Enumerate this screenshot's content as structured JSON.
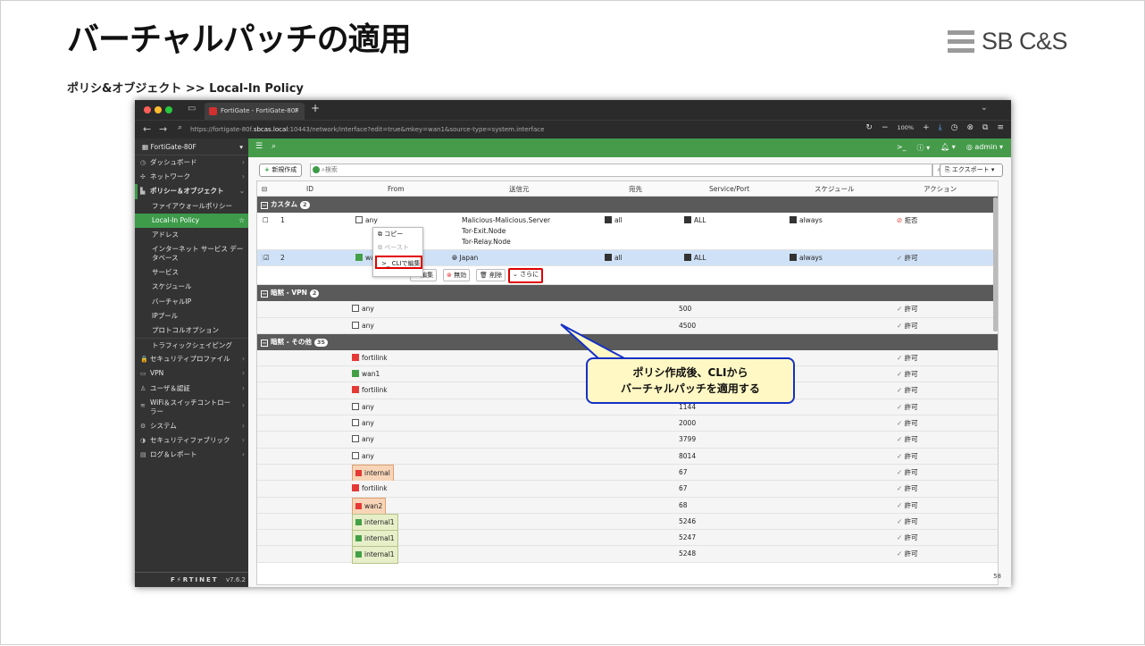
{
  "slide": {
    "title": "バーチャルパッチの適用",
    "brand": "SB C&S",
    "subtitle": "ポリシ&オブジェクト >> Local-In Policy"
  },
  "browser": {
    "tab_title": "FortiGate - FortiGate-80F",
    "url_prefix": "https://fortigate-80f.",
    "url_host": "sbcas.local",
    "url_suffix": ":10443/network/interface?edit=true&mkey=wan1&source-type=system.interface",
    "zoom": "100%"
  },
  "sidebar": {
    "device": "FortiGate-80F",
    "items": [
      {
        "label": "ダッシュボード",
        "icon": "◷",
        "arrow": "›"
      },
      {
        "label": "ネットワーク",
        "icon": "✣",
        "arrow": "›"
      },
      {
        "label": "ポリシー＆オブジェクト",
        "icon": "▙",
        "arrow": "⌄"
      },
      {
        "label": "ファイアウォールポリシー"
      },
      {
        "label": "Local-In Policy"
      },
      {
        "label": "アドレス"
      },
      {
        "label": "インターネット サービス データベース"
      },
      {
        "label": "サービス"
      },
      {
        "label": "スケジュール"
      },
      {
        "label": "バーチャルIP"
      },
      {
        "label": "IPプール"
      },
      {
        "label": "プロトコルオプション"
      },
      {
        "label": "トラフィックシェイピング"
      },
      {
        "label": "セキュリティプロファイル",
        "icon": "🔒",
        "arrow": "›"
      },
      {
        "label": "VPN",
        "icon": "▭",
        "arrow": "›"
      },
      {
        "label": "ユーザ＆認証",
        "icon": "♙",
        "arrow": "›"
      },
      {
        "label": "WiFi＆スイッチコントローラー",
        "icon": "≋",
        "arrow": "›"
      },
      {
        "label": "システム",
        "icon": "⚙",
        "arrow": "›"
      },
      {
        "label": "セキュリティファブリック",
        "icon": "◑",
        "arrow": "›"
      },
      {
        "label": "ログ＆レポート",
        "icon": "▤",
        "arrow": "›"
      }
    ],
    "footer_logo": "F⚡RTINET",
    "version": "v7.6.2"
  },
  "topbar": {
    "user": "admin"
  },
  "toolbar": {
    "new_label": "新規作成",
    "search_placeholder": "検索",
    "export_label": "エクスポート"
  },
  "table": {
    "headers": [
      "ID",
      "From",
      "送信元",
      "宛先",
      "Service/Port",
      "スケジュール",
      "アクション"
    ],
    "groups": {
      "custom": {
        "label": "カスタム",
        "count": "2"
      },
      "vpn": {
        "label": "暗黙 - VPN",
        "count": "2"
      },
      "other": {
        "label": "暗黙 - その他",
        "count": "35"
      }
    },
    "row1": {
      "id": "1",
      "from": "any",
      "src1": "Malicious-Malicious.Server",
      "src2": "Tor-Exit.Node",
      "src3": "Tor-Relay.Node",
      "dst": "all",
      "service": "ALL",
      "schedule": "always",
      "action": "拒否"
    },
    "row2": {
      "id": "2",
      "from": "wan1",
      "src": "Japan",
      "dst": "all",
      "service": "ALL",
      "schedule": "always",
      "action": "許可"
    },
    "actions": {
      "edit": "編集",
      "disable": "無効",
      "delete": "削除",
      "more": "さらに"
    },
    "menu": {
      "copy": "コピー",
      "paste": "ペースト",
      "cli": "CLIで編集"
    },
    "vpn_rows": [
      {
        "from": "any",
        "port": "500",
        "action": "許可"
      },
      {
        "from": "any",
        "port": "4500",
        "action": "許可"
      }
    ],
    "other_rows": [
      {
        "from": "fortilink",
        "port": "",
        "action": "許可",
        "kind": "r"
      },
      {
        "from": "wan1",
        "port": "",
        "action": "許可",
        "kind": "g"
      },
      {
        "from": "fortilink",
        "port": "",
        "action": "許可",
        "kind": "r"
      },
      {
        "from": "any",
        "port": "1144",
        "action": "許可",
        "kind": "b"
      },
      {
        "from": "any",
        "port": "2000",
        "action": "許可",
        "kind": "b"
      },
      {
        "from": "any",
        "port": "3799",
        "action": "許可",
        "kind": "b"
      },
      {
        "from": "any",
        "port": "8014",
        "action": "許可",
        "kind": "b"
      },
      {
        "from": "internal",
        "port": "67",
        "action": "許可",
        "kind": "tag-o"
      },
      {
        "from": "fortilink",
        "port": "67",
        "action": "許可",
        "kind": "r"
      },
      {
        "from": "wan2",
        "port": "68",
        "action": "許可",
        "kind": "tag-o"
      },
      {
        "from": "internal1",
        "port": "5246",
        "action": "許可",
        "kind": "tag-y"
      },
      {
        "from": "internal1",
        "port": "5247",
        "action": "許可",
        "kind": "tag-y"
      },
      {
        "from": "internal1",
        "port": "5248",
        "action": "許可",
        "kind": "tag-y"
      }
    ],
    "page_count": "58"
  },
  "callout": {
    "line1": "ポリシ作成後、CLIから",
    "line2": "バーチャルパッチを適用する"
  }
}
